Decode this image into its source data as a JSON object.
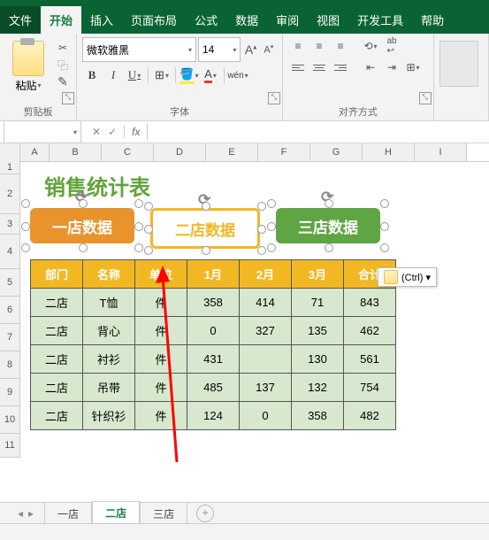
{
  "tabs": {
    "file": "文件",
    "home": "开始",
    "insert": "插入",
    "layout": "页面布局",
    "formula": "公式",
    "data": "数据",
    "review": "审阅",
    "view": "视图",
    "dev": "开发工具",
    "help": "帮助"
  },
  "ribbon": {
    "paste": "粘贴",
    "clipboard": "剪贴板",
    "font": "字体",
    "align": "对齐方式",
    "font_name": "微软雅黑",
    "font_size": "14",
    "inc": "A",
    "dec": "A",
    "bold": "B",
    "italic": "I",
    "underline": "U",
    "wen": "wén"
  },
  "formula_bar": {
    "fx": "fx",
    "x": "✕",
    "check": "✓"
  },
  "columns": [
    "A",
    "B",
    "C",
    "D",
    "E",
    "F",
    "G",
    "H",
    "I"
  ],
  "rows": [
    "1",
    "2",
    "3",
    "4",
    "5",
    "6",
    "7",
    "8",
    "9",
    "10",
    "11"
  ],
  "title": "销售统计表",
  "shapes": {
    "s1": "一店数据",
    "s2": "二店数据",
    "s3": "三店数据"
  },
  "ctrl_label": "(Ctrl) ▾",
  "table": {
    "headers": [
      "部门",
      "名称",
      "单位",
      "1月",
      "2月",
      "3月",
      "合计"
    ],
    "rows": [
      [
        "二店",
        "T恤",
        "件",
        "358",
        "414",
        "71",
        "843"
      ],
      [
        "二店",
        "背心",
        "件",
        "0",
        "327",
        "135",
        "462"
      ],
      [
        "二店",
        "衬衫",
        "件",
        "431",
        "",
        "130",
        "561"
      ],
      [
        "二店",
        "吊带",
        "件",
        "485",
        "137",
        "132",
        "754"
      ],
      [
        "二店",
        "针织衫",
        "件",
        "124",
        "0",
        "358",
        "482"
      ]
    ]
  },
  "sheet_tabs": {
    "t1": "一店",
    "t2": "二店",
    "t3": "三店",
    "add": "+"
  },
  "chart_data": {
    "type": "table",
    "title": "销售统计表",
    "columns": [
      "部门",
      "名称",
      "单位",
      "1月",
      "2月",
      "3月",
      "合计"
    ],
    "rows": [
      {
        "部门": "二店",
        "名称": "T恤",
        "单位": "件",
        "1月": 358,
        "2月": 414,
        "3月": 71,
        "合计": 843
      },
      {
        "部门": "二店",
        "名称": "背心",
        "单位": "件",
        "1月": 0,
        "2月": 327,
        "3月": 135,
        "合计": 462
      },
      {
        "部门": "二店",
        "名称": "衬衫",
        "单位": "件",
        "1月": 431,
        "2月": null,
        "3月": 130,
        "合计": 561
      },
      {
        "部门": "二店",
        "名称": "吊带",
        "单位": "件",
        "1月": 485,
        "2月": 137,
        "3月": 132,
        "合计": 754
      },
      {
        "部门": "二店",
        "名称": "针织衫",
        "单位": "件",
        "1月": 124,
        "2月": 0,
        "3月": 358,
        "合计": 482
      }
    ]
  }
}
